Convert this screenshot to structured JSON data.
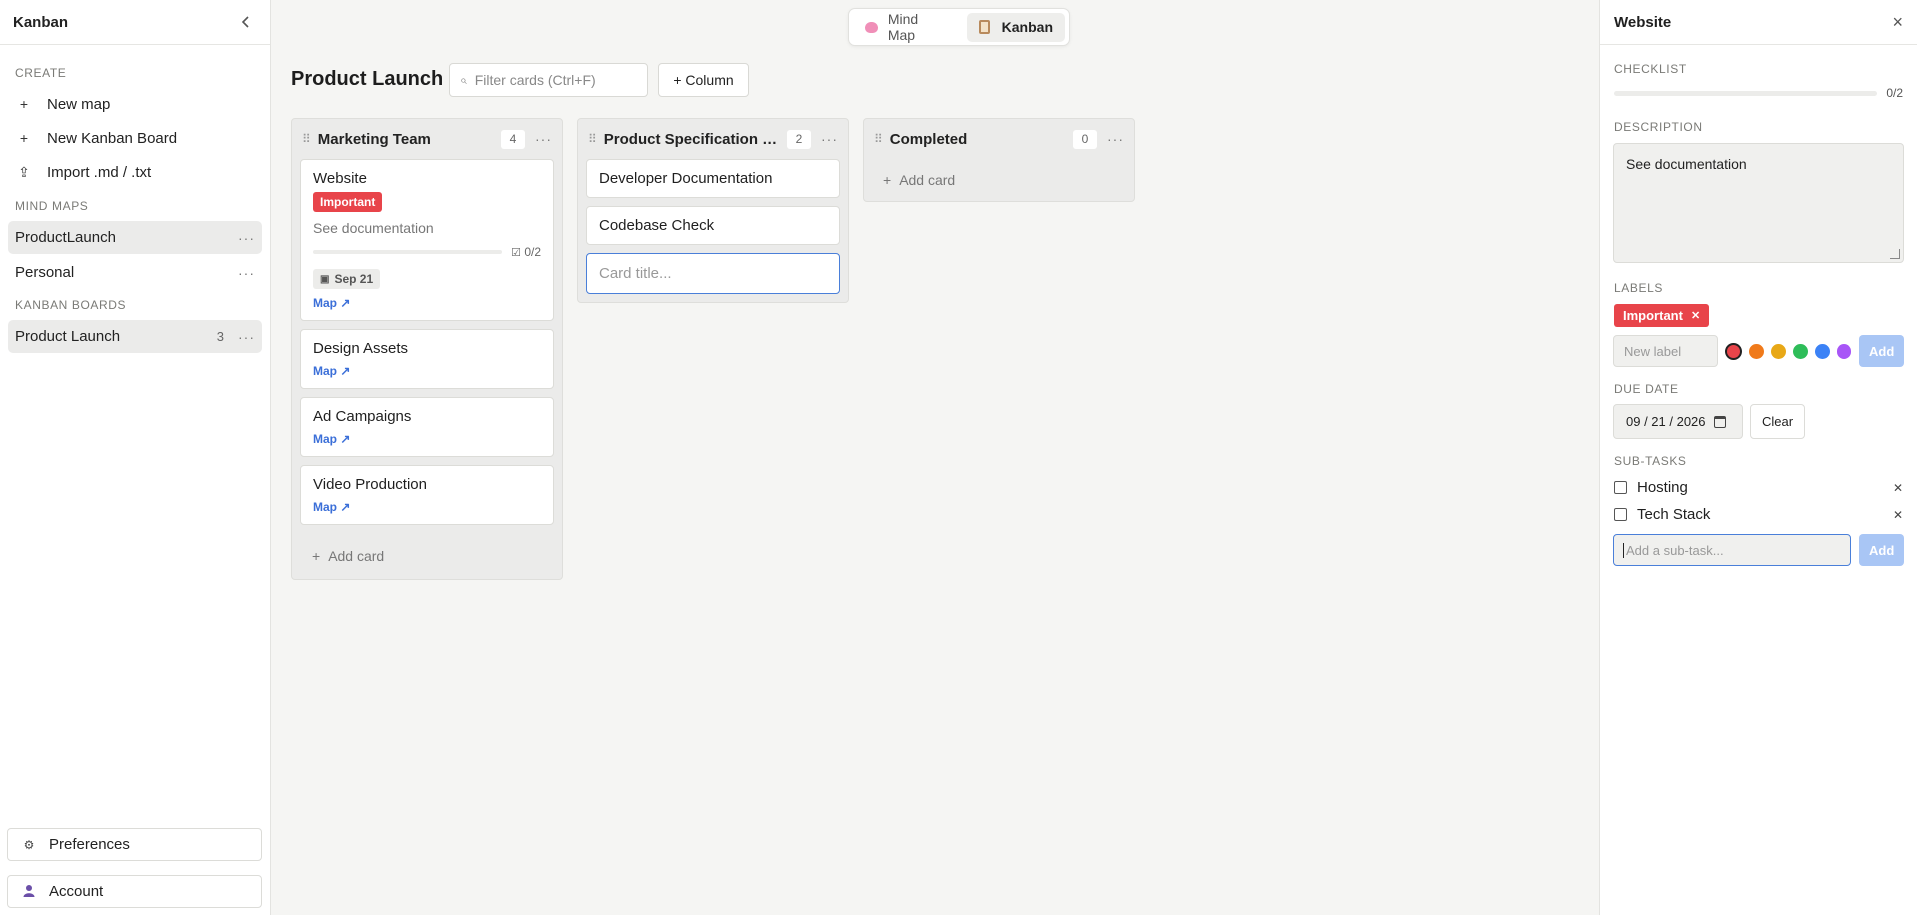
{
  "sidebar": {
    "title": "Kanban",
    "create_label": "CREATE",
    "actions": [
      {
        "icon": "plus-icon",
        "glyph": "+",
        "label": "New map"
      },
      {
        "icon": "plus-icon",
        "glyph": "+",
        "label": "New Kanban Board"
      },
      {
        "icon": "upload-icon",
        "glyph": "⇪",
        "label": "Import .md / .txt"
      }
    ],
    "mind_maps_label": "MIND MAPS",
    "mind_maps": [
      {
        "label": "ProductLaunch",
        "active": true
      },
      {
        "label": "Personal",
        "active": false
      }
    ],
    "kanban_boards_label": "KANBAN BOARDS",
    "kanban_boards": [
      {
        "label": "Product Launch",
        "count": "3",
        "active": true
      }
    ],
    "preferences_label": "Preferences",
    "account_label": "Account"
  },
  "view_toggle": {
    "mind_map_label": "Mind Map",
    "kanban_label": "Kanban",
    "active": "kanban"
  },
  "board": {
    "title": "Product Launch",
    "filter_placeholder": "Filter cards (Ctrl+F)",
    "add_column_label": "+ Column"
  },
  "columns": [
    {
      "title": "Marketing Team",
      "count": "4",
      "cards": [
        {
          "title": "Website",
          "label": "Important",
          "description": "See documentation",
          "progress": "0/2",
          "progress_fraction": 0,
          "due": "Sep 21",
          "map_link": "Map ↗"
        },
        {
          "title": "Design Assets",
          "map_link": "Map ↗"
        },
        {
          "title": "Ad Campaigns",
          "map_link": "Map ↗"
        },
        {
          "title": "Video Production",
          "map_link": "Map ↗"
        }
      ],
      "add_card_label": "Add card"
    },
    {
      "title": "Product Specification D...",
      "count": "2",
      "cards": [
        {
          "title": "Developer Documentation"
        },
        {
          "title": "Codebase Check"
        }
      ],
      "new_card_placeholder": "Card title..."
    },
    {
      "title": "Completed",
      "count": "0",
      "cards": [],
      "add_card_label": "Add card"
    }
  ],
  "detail": {
    "title": "Website",
    "checklist_label": "CHECKLIST",
    "checklist_progress": "0/2",
    "checklist_fraction": 0,
    "description_label": "DESCRIPTION",
    "description": "See documentation",
    "labels_label": "LABELS",
    "labels": [
      {
        "text": "Important",
        "color": "#e8444a"
      }
    ],
    "new_label_placeholder": "New label",
    "label_colors": [
      "#e8444a",
      "#f07a1a",
      "#e8a817",
      "#2ebd59",
      "#3b82f6",
      "#a855f7"
    ],
    "selected_color": "#e8444a",
    "add_label_button": "Add",
    "due_date_label": "DUE DATE",
    "due_date": "09 / 21 / 2026",
    "clear_label": "Clear",
    "subtasks_label": "SUB-TASKS",
    "subtasks": [
      {
        "text": "Hosting",
        "done": false
      },
      {
        "text": "Tech Stack",
        "done": false
      }
    ],
    "subtask_placeholder": "Add a sub-task...",
    "add_subtask_button": "Add"
  }
}
